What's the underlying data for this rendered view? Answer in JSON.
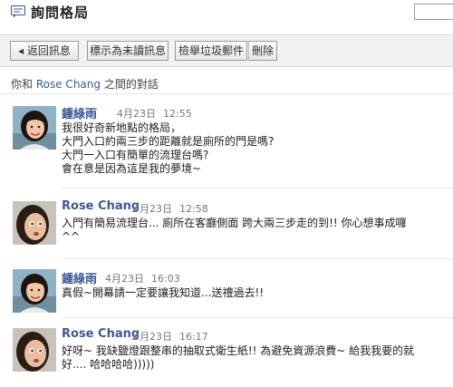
{
  "header": {
    "title": "詢問格局",
    "icon": "message-icon"
  },
  "toolbar": {
    "back_label": "◂ 返回訊息",
    "unread_label": "標示為未讀訊息",
    "spam_label": "檢舉垃圾郵件",
    "delete_label": "刪除"
  },
  "conversation": {
    "prefix": "你和",
    "participant": "Rose Chang",
    "suffix": "之間的對話"
  },
  "messages": [
    {
      "sender": "鍾綠雨",
      "date": "4月23日",
      "time": "12:55",
      "lines": [
        "我很好奇新地點的格局，",
        "大門入口約兩三步的距離就是廁所的門是嗎?",
        "大門一入口有簡單的流理台嗎?",
        "會在意是因為這是我的夢境~"
      ]
    },
    {
      "sender": "Rose Chang",
      "date": "4月23日",
      "time": "12:58",
      "lines": [
        "入門有簡易流理台... 廁所在客廳側面  跨大兩三步走的到!! 你心想事成囉",
        "^^"
      ]
    },
    {
      "sender": "鍾綠雨",
      "date": "4月23日",
      "time": "16:03",
      "lines": [
        "真假~開幕請一定要讓我知道...送禮過去!!"
      ]
    },
    {
      "sender": "Rose Chang",
      "date": "4月23日",
      "time": "16:17",
      "lines": [
        "好呀~ 我缺鹽燈跟整串的抽取式衛生紙!! 為避免資源浪費~ 給我我要的就",
        "好.... 哈哈哈哈)))))"
      ]
    }
  ],
  "colors": {
    "link": "#3b5998",
    "toolbar_bg": "#f2f2f2"
  }
}
